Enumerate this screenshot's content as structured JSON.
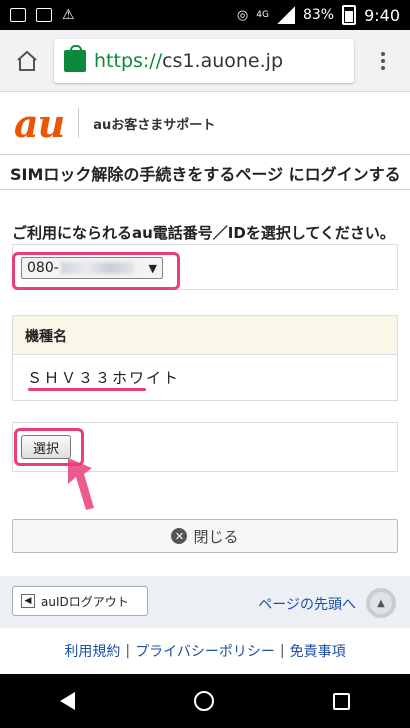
{
  "status_bar": {
    "signal_label": "4G",
    "battery": "83%",
    "time": "9:40"
  },
  "browser": {
    "url_scheme": "https://",
    "url_host": "cs1.auone.jp"
  },
  "header": {
    "logo": "au",
    "support": "auお客さまサポート"
  },
  "page_title": "SIMロック解除の手続きをするページ にログインする",
  "instruction": "ご利用になられるau電話番号／IDを選択してください。",
  "phone_select": {
    "visible_prefix": "080-"
  },
  "model": {
    "header": "機種名",
    "value": "ＳＨＶ３３ホワイト"
  },
  "select_button": "選択",
  "close_button": "閉じる",
  "footer": {
    "logout": "auIDログアウト",
    "to_top": "ページの先頭へ"
  },
  "links": [
    "利用規約",
    "プライバシーポリシー",
    "免責事項"
  ],
  "colors": {
    "accent_pink": "#ea3d7d",
    "au_orange": "#eb5505",
    "link_blue": "#1b4fa8"
  }
}
